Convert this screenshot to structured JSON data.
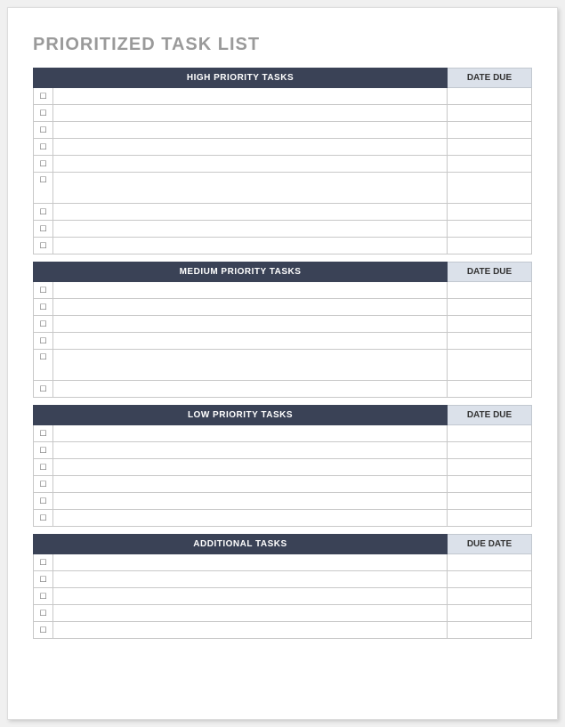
{
  "title": "PRIORITIZED TASK LIST",
  "checkbox_glyph": "☐",
  "sections": [
    {
      "task_header": "HIGH PRIORITY TASKS",
      "date_header": "DATE DUE",
      "large_row_index": 5,
      "rows": 9
    },
    {
      "task_header": "MEDIUM PRIORITY TASKS",
      "date_header": "DATE DUE",
      "large_row_index": 4,
      "rows": 6
    },
    {
      "task_header": "LOW PRIORITY TASKS",
      "date_header": "DATE DUE",
      "large_row_index": -1,
      "rows": 6
    },
    {
      "task_header": "ADDITIONAL TASKS",
      "date_header": "DUE DATE",
      "large_row_index": -1,
      "rows": 5
    }
  ]
}
